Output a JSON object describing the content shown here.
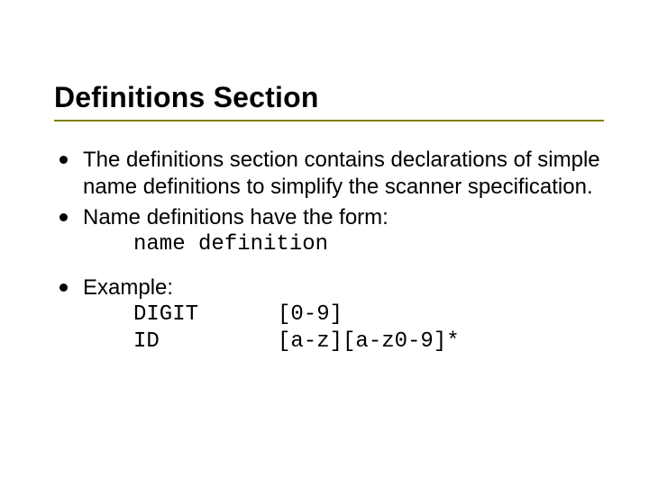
{
  "title": "Definitions Section",
  "bullet1": "The definitions section contains declarations of simple name definitions  to simplify the scanner specification.",
  "bullet2": "Name definitions have the form:",
  "bullet2_code": "name definition",
  "bullet3": "Example:",
  "example": {
    "row1": {
      "name": "DIGIT",
      "def": "[0-9]"
    },
    "row2": {
      "name": "ID",
      "def": "[a-z][a-z0-9]*"
    }
  }
}
